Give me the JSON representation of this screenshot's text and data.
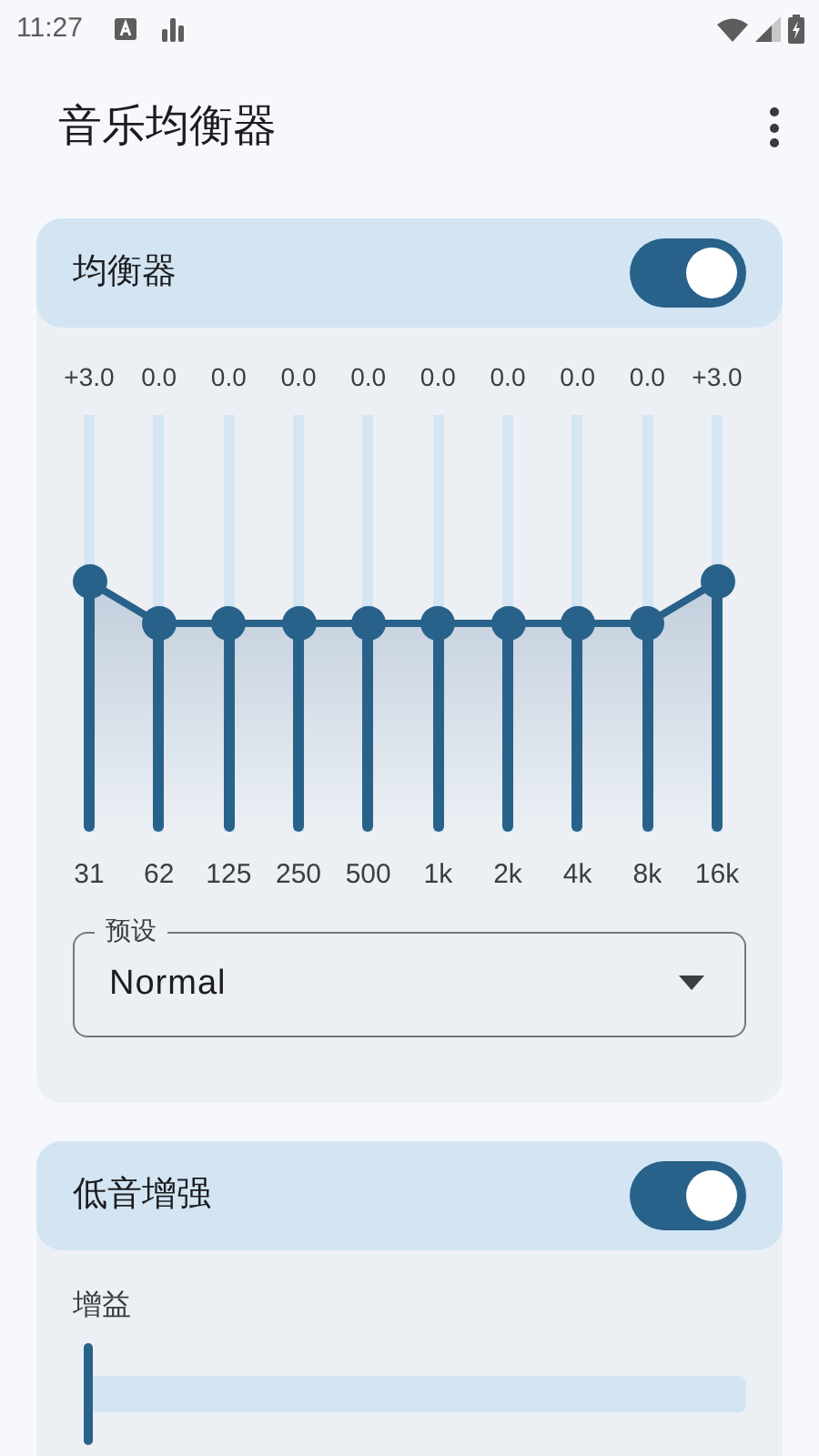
{
  "status_bar": {
    "time": "11:27"
  },
  "app_bar": {
    "title": "音乐均衡器"
  },
  "equalizer": {
    "title": "均衡器",
    "enabled": true,
    "bands": [
      {
        "frequency": "31",
        "reading": "+3.0",
        "level": 0.6
      },
      {
        "frequency": "62",
        "reading": "0.0",
        "level": 0.5
      },
      {
        "frequency": "125",
        "reading": "0.0",
        "level": 0.5
      },
      {
        "frequency": "250",
        "reading": "0.0",
        "level": 0.5
      },
      {
        "frequency": "500",
        "reading": "0.0",
        "level": 0.5
      },
      {
        "frequency": "1k",
        "reading": "0.0",
        "level": 0.5
      },
      {
        "frequency": "2k",
        "reading": "0.0",
        "level": 0.5
      },
      {
        "frequency": "4k",
        "reading": "0.0",
        "level": 0.5
      },
      {
        "frequency": "8k",
        "reading": "0.0",
        "level": 0.5
      },
      {
        "frequency": "16k",
        "reading": "+3.0",
        "level": 0.6
      }
    ],
    "preset": {
      "label": "预设",
      "value": "Normal"
    }
  },
  "bass_boost": {
    "title": "低音增强",
    "enabled": true,
    "gain": {
      "label": "增益",
      "level": 0
    }
  }
}
